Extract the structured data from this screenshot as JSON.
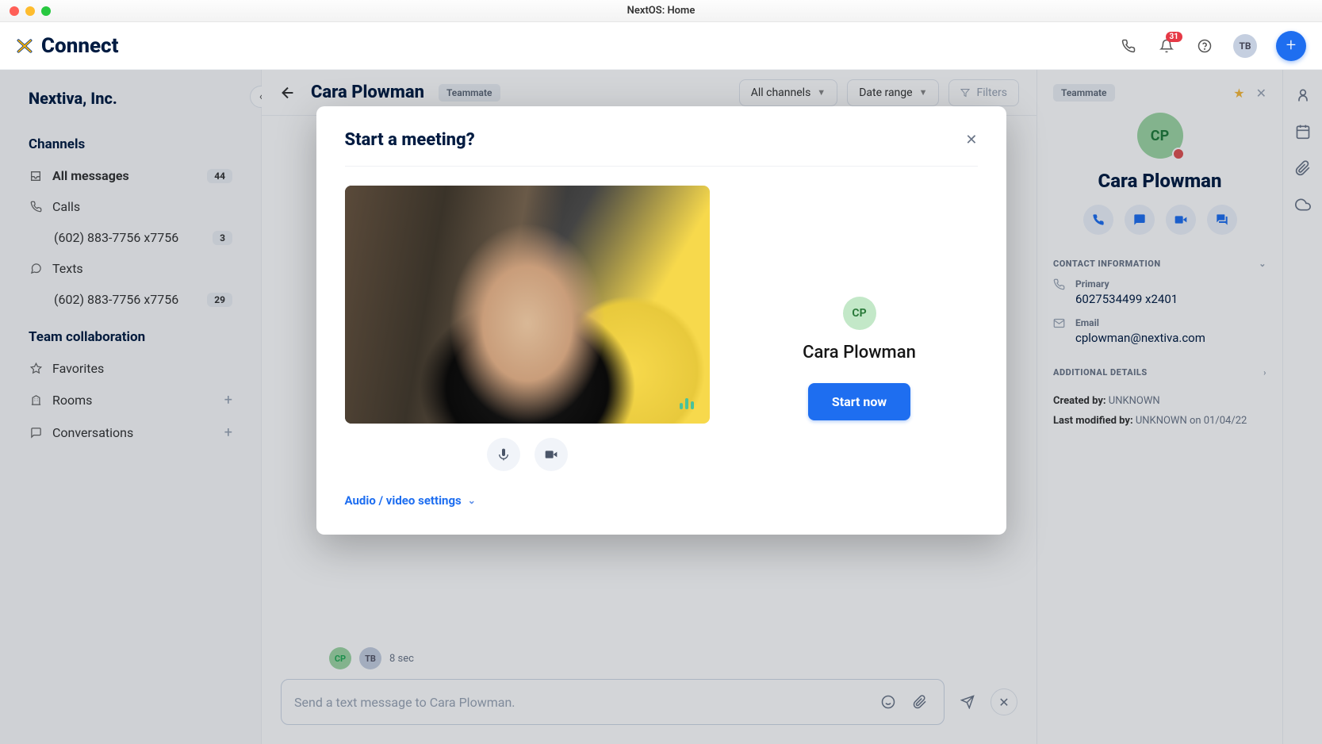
{
  "window": {
    "title": "NextOS: Home"
  },
  "brand": {
    "name": "Connect",
    "logo_glyph": "✕"
  },
  "topbar": {
    "bell_count": "31",
    "avatar_initials": "TB"
  },
  "fab_glyph": "+",
  "sidebar": {
    "org": "Nextiva, Inc.",
    "sections": {
      "channels_label": "Channels",
      "team_label": "Team collaboration"
    },
    "items": {
      "all_messages": {
        "label": "All messages",
        "badge": "44"
      },
      "calls": {
        "label": "Calls"
      },
      "calls_sub": {
        "label": "(602) 883-7756 x7756",
        "badge": "3"
      },
      "texts": {
        "label": "Texts"
      },
      "texts_sub": {
        "label": "(602) 883-7756 x7756",
        "badge": "29"
      },
      "favorites": {
        "label": "Favorites"
      },
      "rooms": {
        "label": "Rooms"
      },
      "conversations": {
        "label": "Conversations"
      }
    }
  },
  "conversation": {
    "name": "Cara Plowman",
    "tag": "Teammate",
    "filters": {
      "channels": "All channels",
      "date": "Date range",
      "filters": "Filters"
    },
    "compose_placeholder": "Send a text message to Cara Plowman.",
    "call_row": {
      "cp": "CP",
      "tb": "TB",
      "duration": "8 sec"
    }
  },
  "detail": {
    "tag": "Teammate",
    "initials": "CP",
    "name": "Cara Plowman",
    "contact_section": "CONTACT INFORMATION",
    "primary_label": "Primary",
    "primary_value": "6027534499 x2401",
    "email_label": "Email",
    "email_value": "cplowman@nextiva.com",
    "additional_section": "ADDITIONAL DETAILS",
    "created_label": "Created by:",
    "created_value": "UNKNOWN",
    "modified_label": "Last modified by:",
    "modified_value": "UNKNOWN on 01/04/22"
  },
  "modal": {
    "title": "Start a meeting?",
    "side_initials": "CP",
    "side_name": "Cara Plowman",
    "start_label": "Start now",
    "settings_label": "Audio / video settings"
  }
}
